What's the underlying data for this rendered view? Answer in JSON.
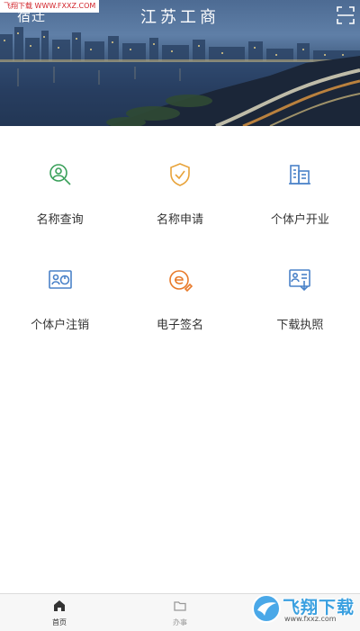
{
  "watermark_top": "飞翔下载 WWW.FXXZ.COM",
  "header": {
    "city": "宿迁",
    "title": "江苏工商",
    "scan_icon": "scan-icon"
  },
  "services": [
    {
      "id": "name-query",
      "label": "名称查询",
      "icon": "person-search-icon",
      "color": "#3aa05a"
    },
    {
      "id": "name-apply",
      "label": "名称申请",
      "icon": "shield-check-icon",
      "color": "#e8a33a"
    },
    {
      "id": "individual-open",
      "label": "个体户开业",
      "icon": "building-icon",
      "color": "#4a82c8"
    },
    {
      "id": "individual-cancel",
      "label": "个体户注销",
      "icon": "person-power-icon",
      "color": "#4a82c8"
    },
    {
      "id": "e-sign",
      "label": "电子签名",
      "icon": "e-sign-icon",
      "color": "#e87a2a"
    },
    {
      "id": "download-license",
      "label": "下载执照",
      "icon": "license-download-icon",
      "color": "#4a82c8"
    }
  ],
  "tabbar": {
    "home_label": "首页",
    "work_label": "办事"
  },
  "watermark_logo": {
    "name": "飞翔下载",
    "url": "www.fxxz.com"
  }
}
